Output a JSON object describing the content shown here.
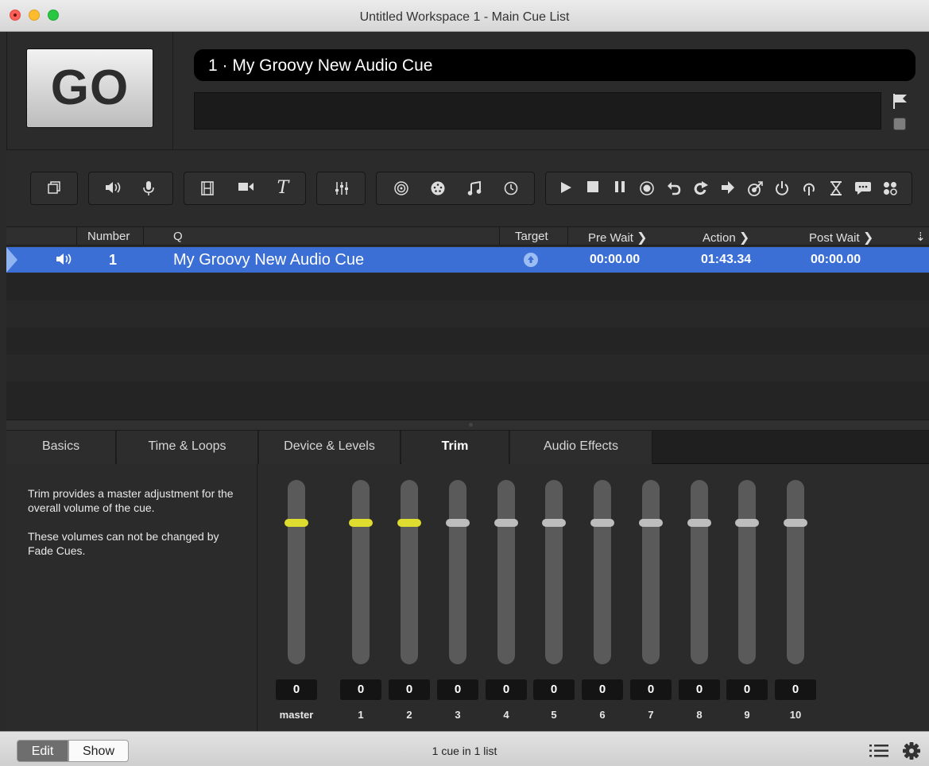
{
  "window": {
    "title": "Untitled Workspace 1 - Main Cue List"
  },
  "header": {
    "go_label": "GO",
    "standby_cue": "1 · My Groovy New Audio Cue",
    "notes": ""
  },
  "toolbar": {
    "groups": [
      {
        "name": "group",
        "icons": [
          "group-icon"
        ]
      },
      {
        "name": "audio",
        "icons": [
          "audio-cue-icon",
          "mic-cue-icon"
        ]
      },
      {
        "name": "video",
        "icons": [
          "video-cue-icon",
          "camera-cue-icon",
          "text-cue-icon"
        ]
      },
      {
        "name": "fade",
        "icons": [
          "fade-cue-icon"
        ]
      },
      {
        "name": "control",
        "icons": [
          "network-cue-icon",
          "midi-cue-icon",
          "midi-file-cue-icon",
          "timecode-cue-icon"
        ]
      },
      {
        "name": "transport",
        "icons": [
          "start-cue-icon",
          "stop-cue-icon",
          "pause-cue-icon",
          "load-cue-icon",
          "reset-cue-icon",
          "devamp-cue-icon",
          "goto-cue-icon",
          "target-cue-icon",
          "arm-cue-icon",
          "disarm-cue-icon",
          "wait-cue-icon",
          "memo-cue-icon",
          "script-cue-icon"
        ]
      }
    ]
  },
  "table": {
    "columns": {
      "number": "Number",
      "q": "Q",
      "target": "Target",
      "pre_wait": "Pre Wait",
      "action": "Action",
      "post_wait": "Post Wait"
    },
    "rows": [
      {
        "type_icon": "speaker-icon",
        "number": "1",
        "name": "My Groovy New Audio Cue",
        "target_icon": "target-arrow-icon",
        "pre_wait": "00:00.00",
        "action": "01:43.34",
        "post_wait": "00:00.00"
      }
    ]
  },
  "inspector": {
    "tabs": [
      "Basics",
      "Time & Loops",
      "Device & Levels",
      "Trim",
      "Audio Effects"
    ],
    "active_tab": "Trim",
    "description_1": "Trim provides a master adjustment for the overall volume of the cue.",
    "description_2": "These volumes can not be changed by Fade Cues.",
    "faders": [
      {
        "label": "master",
        "value": "0",
        "active": true
      },
      {
        "label": "1",
        "value": "0",
        "active": true
      },
      {
        "label": "2",
        "value": "0",
        "active": true
      },
      {
        "label": "3",
        "value": "0",
        "active": false
      },
      {
        "label": "4",
        "value": "0",
        "active": false
      },
      {
        "label": "5",
        "value": "0",
        "active": false
      },
      {
        "label": "6",
        "value": "0",
        "active": false
      },
      {
        "label": "7",
        "value": "0",
        "active": false
      },
      {
        "label": "8",
        "value": "0",
        "active": false
      },
      {
        "label": "9",
        "value": "0",
        "active": false
      },
      {
        "label": "10",
        "value": "0",
        "active": false
      }
    ]
  },
  "statusbar": {
    "edit_label": "Edit",
    "show_label": "Show",
    "status": "1 cue in 1 list"
  }
}
